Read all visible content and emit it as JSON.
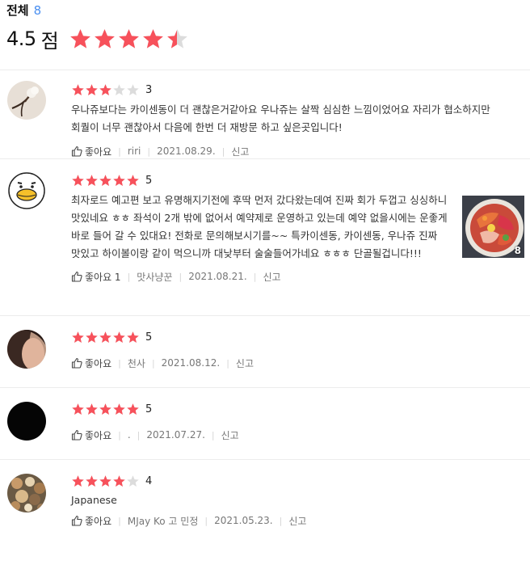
{
  "header": {
    "total_label": "전체",
    "total_count": "8",
    "avg_score": "4.5",
    "avg_unit": "점",
    "avg_rating": 4.5
  },
  "colors": {
    "star_on": "#f7515b",
    "star_off": "#dcdcdc",
    "accent_blue": "#4a8ff0"
  },
  "reviews": [
    {
      "rating": 3,
      "rating_text": "3",
      "text": "우나쥬보다는 카이센동이 더 괜찮은거같아요 우나쥬는 살짝 심심한 느낌이었어요 자리가 협소하지만 회퀄이 너무 괜찮아서 다음에 한번 더 재방문 하고 싶은곳입니다!",
      "like_label": "좋아요",
      "author": "riri",
      "date": "2021.08.29.",
      "report_label": "신고",
      "avatar_icon": "cotton-flower-avatar"
    },
    {
      "rating": 5,
      "rating_text": "5",
      "text": "최자로드 예고편 보고 유명해지기전에 후딱 먼저 갔다왔는데여 진짜 회가 두껍고 싱싱하니 맛있네요 ㅎㅎ 좌석이 2개 밖에 없어서 예약제로 운영하고 있는데 예약 없을시에는 운좋게 바로 들어 갈 수 있대요! 전화로 문의해보시기를~~ 특카이센동, 카이센동, 우나쥬 진짜 맛있고 하이볼이랑 같이 먹으니까 대낮부터 술술들어가네요 ㅎㅎㅎ 단골될겁니다!!!",
      "like_label": "좋아요 1",
      "author": "맛사냥꾼",
      "date": "2021.08.21.",
      "report_label": "신고",
      "avatar_icon": "duck-avatar",
      "photo_count": "8",
      "photo_icon": "kaisendon-photo"
    },
    {
      "rating": 5,
      "rating_text": "5",
      "text": "",
      "like_label": "좋아요",
      "author": "천사",
      "date": "2021.08.12.",
      "report_label": "신고",
      "avatar_icon": "person-avatar"
    },
    {
      "rating": 5,
      "rating_text": "5",
      "text": "",
      "like_label": "좋아요",
      "author": ".",
      "date": "2021.07.27.",
      "report_label": "신고",
      "avatar_icon": "black-avatar"
    },
    {
      "rating": 4,
      "rating_text": "4",
      "text": "Japanese",
      "like_label": "좋아요",
      "author": "MJay Ko 고 민정",
      "date": "2021.05.23.",
      "report_label": "신고",
      "avatar_icon": "flowers-avatar"
    }
  ]
}
